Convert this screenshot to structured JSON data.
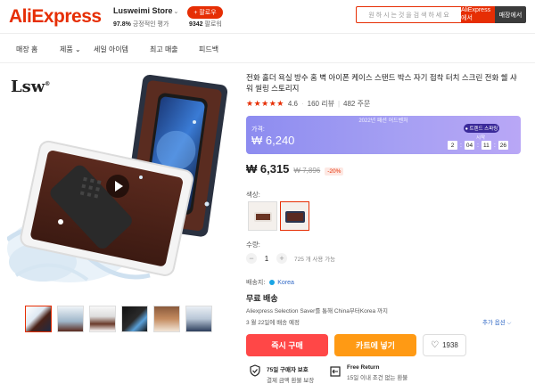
{
  "header": {
    "logo": "AliExpress",
    "store_name": "Lusweimi Store",
    "store_rating_value": "97.8%",
    "store_rating_label": "긍정적인 평가",
    "follow_label": "+ 팔로우",
    "followers_value": "9342",
    "followers_label": "팔로워",
    "search_placeholder": "원 하 시 는 것 을 검 색 하 세 요",
    "search_aliexpress": "AliExpress에서",
    "search_store": "매장에서"
  },
  "nav": {
    "items": [
      "매장 홈",
      "제품",
      "세일 아이템",
      "최고 매출",
      "피드백"
    ]
  },
  "product": {
    "title": "전화 홀더 욕실 방수 홈 벽 아이폰 케이스 스탠드 박스 자기 접착 터치 스크린 전화 쉘 샤워 씰링 스토리지",
    "stars": "★★★★★",
    "rating": "4.6",
    "reviews": "160 리뷰",
    "orders": "482 주문",
    "promo": {
      "tag": "2022년 패션 어드벤처",
      "label": "가격:",
      "price": "₩ 6,240",
      "badge": "● 트렌드 스파링",
      "sub": "시작",
      "countdown": [
        "2",
        "04",
        "11",
        "26"
      ]
    },
    "price": "₩ 6,315",
    "old_price": "₩ 7,896",
    "discount": "-20%",
    "color_label": "색상:",
    "qty_label": "수량:",
    "qty_value": "1",
    "qty_minus": "−",
    "qty_plus": "+",
    "qty_note": "725 개 사용 가능",
    "ship_to_label": "배송지:",
    "ship_country": "Korea",
    "ship_title": "무료 배송",
    "ship_detail": "Aliexpress Selection Saver를 통해 China부터Korea 까지",
    "ship_date": "3 월 22일에 배송 예정",
    "more_options": "추가 옵션 ⌵",
    "buy_now": "즉시 구매",
    "add_cart": "카트에 넣기",
    "wishlist_count": "1938",
    "guarantees": [
      {
        "title": "75일 구매자 보호",
        "sub": "결제 금액 환불 보장"
      },
      {
        "title": "Free Return",
        "sub": "15일 이내 조건 없는 환불"
      }
    ]
  },
  "colors": {
    "accent": "#e62e04",
    "buy": "#ff4747",
    "cart": "#ff9a14",
    "promo_start": "#8d8cf0",
    "promo_end": "#b9a7f6"
  }
}
